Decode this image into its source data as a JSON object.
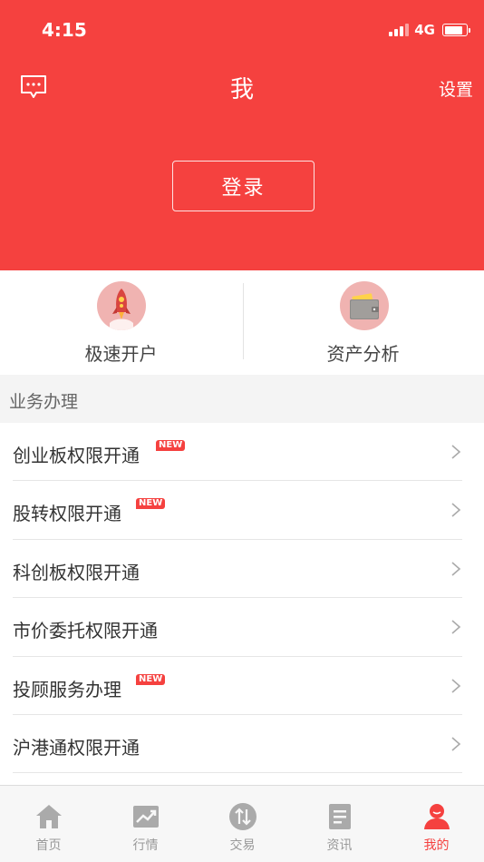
{
  "status_bar": {
    "time": "4:15",
    "network": "4G"
  },
  "header": {
    "title": "我",
    "settings_label": "设置",
    "login_label": "登录"
  },
  "quick_actions": [
    {
      "label": "极速开户",
      "icon": "rocket-icon"
    },
    {
      "label": "资产分析",
      "icon": "wallet-icon"
    }
  ],
  "section": {
    "title": "业务办理"
  },
  "menu": [
    {
      "label": "创业板权限开通",
      "badge": "NEW"
    },
    {
      "label": "股转权限开通",
      "badge": "NEW"
    },
    {
      "label": "科创板权限开通",
      "badge": ""
    },
    {
      "label": "市价委托权限开通",
      "badge": ""
    },
    {
      "label": "投顾服务办理",
      "badge": "NEW"
    },
    {
      "label": "沪港通权限开通",
      "badge": ""
    }
  ],
  "tabs": [
    {
      "label": "首页",
      "icon": "home-icon",
      "active": false
    },
    {
      "label": "行情",
      "icon": "chart-icon",
      "active": false
    },
    {
      "label": "交易",
      "icon": "exchange-icon",
      "active": false
    },
    {
      "label": "资讯",
      "icon": "news-icon",
      "active": false
    },
    {
      "label": "我的",
      "icon": "user-icon",
      "active": true
    }
  ],
  "colors": {
    "brand_red": "#f5413f",
    "tab_inactive": "#999999"
  }
}
